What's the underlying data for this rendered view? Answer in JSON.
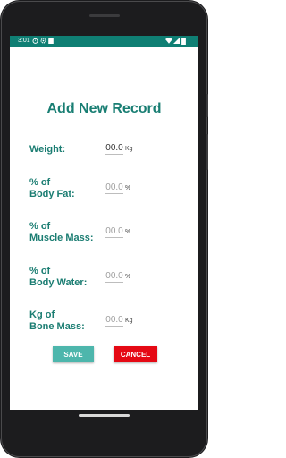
{
  "status_bar": {
    "time": "3:01",
    "left_icons": [
      "alarm-icon",
      "settings-icon",
      "sd-card-icon"
    ],
    "right_icons": [
      "wifi-icon",
      "signal-icon",
      "battery-icon"
    ]
  },
  "page_title": "Add New Record",
  "fields": [
    {
      "label": "Weight:",
      "value": "00.0",
      "unit": "Kg",
      "is_hint": false
    },
    {
      "label": "% of\nBody Fat:",
      "value": "00.0",
      "unit": "%",
      "is_hint": true
    },
    {
      "label": "% of\nMuscle Mass:",
      "value": "00.0",
      "unit": "%",
      "is_hint": true
    },
    {
      "label": "% of\nBody Water:",
      "value": "00.0",
      "unit": "%",
      "is_hint": true
    },
    {
      "label": "Kg of\nBone Mass:",
      "value": "00.0",
      "unit": "Kg",
      "is_hint": true
    }
  ],
  "buttons": {
    "save_label": "SAVE",
    "cancel_label": "CANCEL"
  },
  "colors": {
    "status_bar": "#0f7f74",
    "accent_text": "#1b7d72",
    "save_button": "#4db6ac",
    "cancel_button": "#e50914"
  }
}
